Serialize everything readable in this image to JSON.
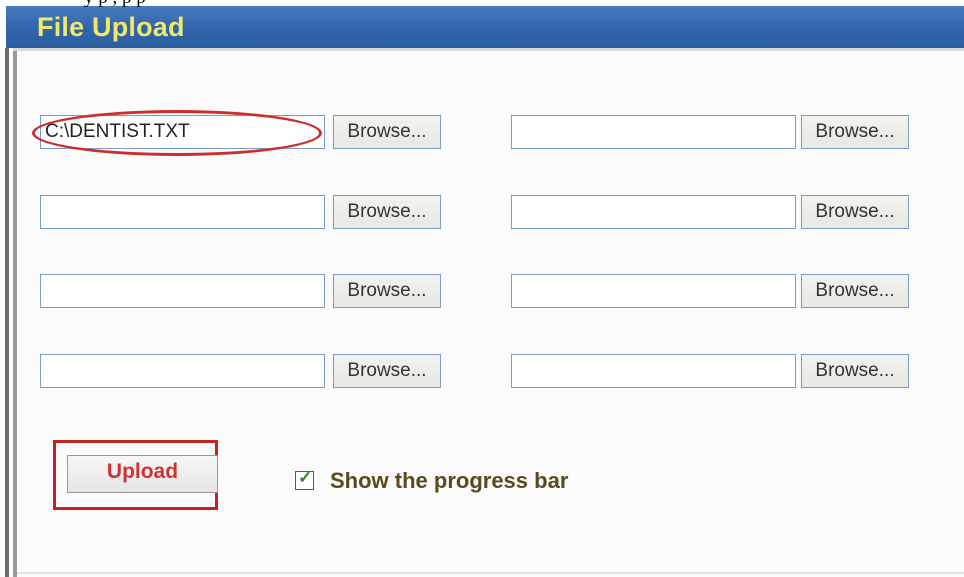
{
  "window": {
    "title": "File Upload",
    "clipped_text_above": "y                                                  p  ,  p         p"
  },
  "file_fields": [
    {
      "value": "C:\\DENTIST.TXT",
      "browse_label": "Browse..."
    },
    {
      "value": "",
      "browse_label": "Browse..."
    },
    {
      "value": "",
      "browse_label": "Browse..."
    },
    {
      "value": "",
      "browse_label": "Browse..."
    },
    {
      "value": "",
      "browse_label": "Browse..."
    },
    {
      "value": "",
      "browse_label": "Browse..."
    },
    {
      "value": "",
      "browse_label": "Browse..."
    },
    {
      "value": "",
      "browse_label": "Browse..."
    }
  ],
  "actions": {
    "upload_label": "Upload",
    "progress_checkbox_label": "Show the progress bar",
    "progress_checkbox_checked": true
  },
  "annotations": {
    "highlight_color": "#cc2e2e",
    "highlight_items": [
      "first-file-field",
      "upload-button"
    ]
  }
}
